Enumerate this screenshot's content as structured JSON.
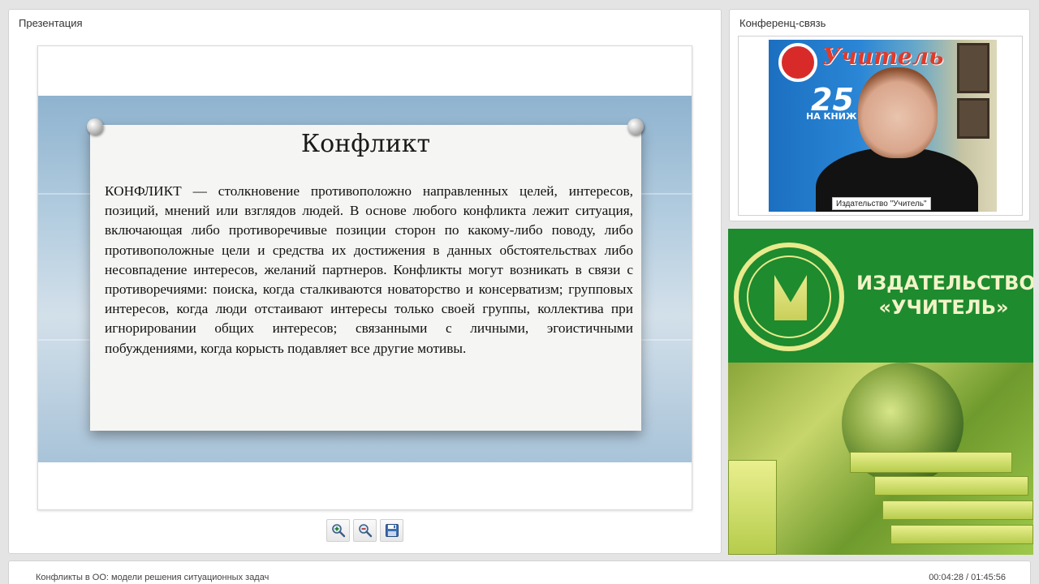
{
  "presentation": {
    "title": "Презентация",
    "slide": {
      "heading": "Конфликт",
      "body": "КОНФЛИКТ — столкновение противоположно направленных целей, интересов, позиций, мнений или взглядов людей. В основе любого конфликта лежит ситуация, включающая либо противоречивые позиции сторон по какому-либо поводу, либо противоположные цели и средства их достижения в данных обстоятельствах либо несовпадение интересов, желаний партнеров. Конфликты могут возникать в связи с противоречиями: поиска, когда сталкиваются новаторство и консерватизм; групповых интересов, когда люди отстаивают интересы только своей группы, коллектива при игнорировании общих интересов; связанными с личными, эгоистичными побуждениями, когда корысть подавляет все другие мотивы."
    },
    "tools": [
      {
        "name": "zoom-in-button",
        "icon": "zoom-in-icon"
      },
      {
        "name": "zoom-out-button",
        "icon": "zoom-out-icon"
      },
      {
        "name": "save-button",
        "icon": "floppy-disk-icon"
      }
    ]
  },
  "conference": {
    "title": "Конференц-связь",
    "video": {
      "banner_text": "Учитель",
      "banner_number": "25",
      "banner_sub": "НА КНИЖ",
      "caption": "Издательство \"Учитель\""
    }
  },
  "publisher": {
    "line1": "ИЗДАТЕЛЬСТВО",
    "line2": "«УЧИТЕЛЬ»",
    "brand_color": "#1d8b2e",
    "text_color": "#f3f3c8"
  },
  "footer": {
    "title": "Конфликты в ОО: модели решения ситуационных задач",
    "time": "00:04:28 / 01:45:56"
  }
}
